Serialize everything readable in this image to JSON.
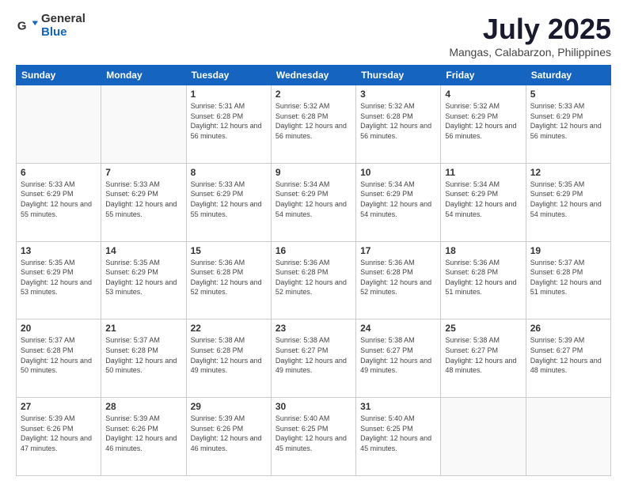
{
  "logo": {
    "general": "General",
    "blue": "Blue"
  },
  "header": {
    "title": "July 2025",
    "subtitle": "Mangas, Calabarzon, Philippines"
  },
  "weekdays": [
    "Sunday",
    "Monday",
    "Tuesday",
    "Wednesday",
    "Thursday",
    "Friday",
    "Saturday"
  ],
  "weeks": [
    [
      {
        "day": null
      },
      {
        "day": null
      },
      {
        "day": "1",
        "sunrise": "Sunrise: 5:31 AM",
        "sunset": "Sunset: 6:28 PM",
        "daylight": "Daylight: 12 hours and 56 minutes."
      },
      {
        "day": "2",
        "sunrise": "Sunrise: 5:32 AM",
        "sunset": "Sunset: 6:28 PM",
        "daylight": "Daylight: 12 hours and 56 minutes."
      },
      {
        "day": "3",
        "sunrise": "Sunrise: 5:32 AM",
        "sunset": "Sunset: 6:28 PM",
        "daylight": "Daylight: 12 hours and 56 minutes."
      },
      {
        "day": "4",
        "sunrise": "Sunrise: 5:32 AM",
        "sunset": "Sunset: 6:29 PM",
        "daylight": "Daylight: 12 hours and 56 minutes."
      },
      {
        "day": "5",
        "sunrise": "Sunrise: 5:33 AM",
        "sunset": "Sunset: 6:29 PM",
        "daylight": "Daylight: 12 hours and 56 minutes."
      }
    ],
    [
      {
        "day": "6",
        "sunrise": "Sunrise: 5:33 AM",
        "sunset": "Sunset: 6:29 PM",
        "daylight": "Daylight: 12 hours and 55 minutes."
      },
      {
        "day": "7",
        "sunrise": "Sunrise: 5:33 AM",
        "sunset": "Sunset: 6:29 PM",
        "daylight": "Daylight: 12 hours and 55 minutes."
      },
      {
        "day": "8",
        "sunrise": "Sunrise: 5:33 AM",
        "sunset": "Sunset: 6:29 PM",
        "daylight": "Daylight: 12 hours and 55 minutes."
      },
      {
        "day": "9",
        "sunrise": "Sunrise: 5:34 AM",
        "sunset": "Sunset: 6:29 PM",
        "daylight": "Daylight: 12 hours and 54 minutes."
      },
      {
        "day": "10",
        "sunrise": "Sunrise: 5:34 AM",
        "sunset": "Sunset: 6:29 PM",
        "daylight": "Daylight: 12 hours and 54 minutes."
      },
      {
        "day": "11",
        "sunrise": "Sunrise: 5:34 AM",
        "sunset": "Sunset: 6:29 PM",
        "daylight": "Daylight: 12 hours and 54 minutes."
      },
      {
        "day": "12",
        "sunrise": "Sunrise: 5:35 AM",
        "sunset": "Sunset: 6:29 PM",
        "daylight": "Daylight: 12 hours and 54 minutes."
      }
    ],
    [
      {
        "day": "13",
        "sunrise": "Sunrise: 5:35 AM",
        "sunset": "Sunset: 6:29 PM",
        "daylight": "Daylight: 12 hours and 53 minutes."
      },
      {
        "day": "14",
        "sunrise": "Sunrise: 5:35 AM",
        "sunset": "Sunset: 6:29 PM",
        "daylight": "Daylight: 12 hours and 53 minutes."
      },
      {
        "day": "15",
        "sunrise": "Sunrise: 5:36 AM",
        "sunset": "Sunset: 6:28 PM",
        "daylight": "Daylight: 12 hours and 52 minutes."
      },
      {
        "day": "16",
        "sunrise": "Sunrise: 5:36 AM",
        "sunset": "Sunset: 6:28 PM",
        "daylight": "Daylight: 12 hours and 52 minutes."
      },
      {
        "day": "17",
        "sunrise": "Sunrise: 5:36 AM",
        "sunset": "Sunset: 6:28 PM",
        "daylight": "Daylight: 12 hours and 52 minutes."
      },
      {
        "day": "18",
        "sunrise": "Sunrise: 5:36 AM",
        "sunset": "Sunset: 6:28 PM",
        "daylight": "Daylight: 12 hours and 51 minutes."
      },
      {
        "day": "19",
        "sunrise": "Sunrise: 5:37 AM",
        "sunset": "Sunset: 6:28 PM",
        "daylight": "Daylight: 12 hours and 51 minutes."
      }
    ],
    [
      {
        "day": "20",
        "sunrise": "Sunrise: 5:37 AM",
        "sunset": "Sunset: 6:28 PM",
        "daylight": "Daylight: 12 hours and 50 minutes."
      },
      {
        "day": "21",
        "sunrise": "Sunrise: 5:37 AM",
        "sunset": "Sunset: 6:28 PM",
        "daylight": "Daylight: 12 hours and 50 minutes."
      },
      {
        "day": "22",
        "sunrise": "Sunrise: 5:38 AM",
        "sunset": "Sunset: 6:28 PM",
        "daylight": "Daylight: 12 hours and 49 minutes."
      },
      {
        "day": "23",
        "sunrise": "Sunrise: 5:38 AM",
        "sunset": "Sunset: 6:27 PM",
        "daylight": "Daylight: 12 hours and 49 minutes."
      },
      {
        "day": "24",
        "sunrise": "Sunrise: 5:38 AM",
        "sunset": "Sunset: 6:27 PM",
        "daylight": "Daylight: 12 hours and 49 minutes."
      },
      {
        "day": "25",
        "sunrise": "Sunrise: 5:38 AM",
        "sunset": "Sunset: 6:27 PM",
        "daylight": "Daylight: 12 hours and 48 minutes."
      },
      {
        "day": "26",
        "sunrise": "Sunrise: 5:39 AM",
        "sunset": "Sunset: 6:27 PM",
        "daylight": "Daylight: 12 hours and 48 minutes."
      }
    ],
    [
      {
        "day": "27",
        "sunrise": "Sunrise: 5:39 AM",
        "sunset": "Sunset: 6:26 PM",
        "daylight": "Daylight: 12 hours and 47 minutes."
      },
      {
        "day": "28",
        "sunrise": "Sunrise: 5:39 AM",
        "sunset": "Sunset: 6:26 PM",
        "daylight": "Daylight: 12 hours and 46 minutes."
      },
      {
        "day": "29",
        "sunrise": "Sunrise: 5:39 AM",
        "sunset": "Sunset: 6:26 PM",
        "daylight": "Daylight: 12 hours and 46 minutes."
      },
      {
        "day": "30",
        "sunrise": "Sunrise: 5:40 AM",
        "sunset": "Sunset: 6:25 PM",
        "daylight": "Daylight: 12 hours and 45 minutes."
      },
      {
        "day": "31",
        "sunrise": "Sunrise: 5:40 AM",
        "sunset": "Sunset: 6:25 PM",
        "daylight": "Daylight: 12 hours and 45 minutes."
      },
      {
        "day": null
      },
      {
        "day": null
      }
    ]
  ]
}
